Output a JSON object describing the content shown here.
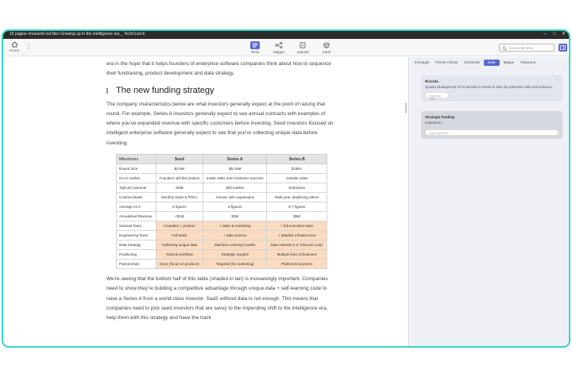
{
  "window": {
    "title": "15 pagine rimanenti nel libro Growing up in the intelligence era _ TechCrunch",
    "controls": [
      "–",
      "□",
      "✕"
    ]
  },
  "toolbar": {
    "home_label": "Home",
    "tools": [
      {
        "label": "Testo",
        "icon": "text-icon",
        "active": true
      },
      {
        "label": "Mappa",
        "icon": "mindmap-icon",
        "active": false
      },
      {
        "label": "Appunti",
        "icon": "notes-icon",
        "active": false
      },
      {
        "label": "Carol",
        "icon": "cube-icon",
        "active": false
      }
    ],
    "search_placeholder": "Cerca nel testo"
  },
  "document": {
    "intro": "era in the hope that it helps founders of enterprise software companies think about how to sequence their fundraising, product development and data strategy.",
    "heading": "The new funding strategy",
    "para1": "The company characteristics below are what investors generally expect at the point of raising that round. For example, Series A investors generally expect to see annual contracts with examples of where you’ve expanded revenue with specific customers before investing. Seed investors focused on intelligent enterprise software generally expect to see that you’re collecting unique data before investing.",
    "table": {
      "headers": [
        "Milestones",
        "Seed",
        "Series A",
        "Series B"
      ],
      "rows": [
        {
          "cells": [
            "Round Size",
            "$2-5M",
            "$5-15M",
            "$15M+"
          ],
          "tan": false
        },
        {
          "cells": [
            "Go to market",
            "Founders sell the product",
            "Inside sales and Customer Success",
            "Outside sales"
          ],
          "tan": false
        },
        {
          "cells": [
            "Typical Customer",
            "SMB",
            "Mid-market",
            "Enterprise"
          ],
          "tan": false
        },
        {
          "cells": [
            "Contract Basis",
            "Monthly SaaS & POCs",
            "Annual, with expansions",
            "Multi-year, displacing others"
          ],
          "tan": false
        },
        {
          "cells": [
            "Average ACV",
            "5 figures",
            "6 figures",
            "6-7 figures"
          ],
          "tan": false
        },
        {
          "cells": [
            "Annualized Revenue",
            "<$1M",
            "$3M",
            "$5M"
          ],
          "tan": false
        },
        {
          "cells": [
            "General Team",
            "Founders + product",
            "+ sales & marketing",
            "+ full executive team"
          ],
          "tan": true
        },
        {
          "cells": [
            "Engineering Team",
            "Full-stack",
            "+ data science",
            "+ data/ML infrastructure"
          ],
          "tan": true
        },
        {
          "cells": [
            "Data Strategy",
            "Collecting unique data",
            "Machine Learning models",
            "Data network is a “Virtuous Loop”"
          ],
          "tan": true
        },
        {
          "cells": [
            "Positioning",
            "Tactical workflow",
            "Strategic insights",
            "Multiple lines of business"
          ],
          "tan": true
        },
        {
          "cells": [
            "Partnerships",
            "None (focus on product!)",
            "Targeted (for marketing)",
            "Platform/ecosystem"
          ],
          "tan": true
        }
      ]
    },
    "para2": "We’re seeing that the bottom half of this table (shaded in tan) is increasingly important. Companies need to show they’re building a competitive advantage through unique data + self-learning code to raise a Series A from a world-class investor. SaaS without data is not enough. This means that companies need to pick seed investors that are savvy to the impending shift to the intelligence era, help them with this strategy and have the track"
  },
  "side_panel": {
    "tabs": [
      {
        "label": "Immagini",
        "active": false
      },
      {
        "label": "Parole Chiave",
        "active": false
      },
      {
        "label": "Domande",
        "active": false
      },
      {
        "label": "Note",
        "active": true
      },
      {
        "label": "Mappe",
        "active": false
      },
      {
        "label": "Riassunti",
        "active": false
      }
    ],
    "cards": [
      {
        "title": "Ricorda",
        "subtitle": "Quanta stratagemma mi ha lanciato in mente le date dei professori nella scena bianca",
        "input_placeholder": "Aggiungi testo..."
      },
      {
        "title": "Strategia funding",
        "subtitle": "Importante...",
        "input_placeholder": "Aggiungi testo..."
      }
    ]
  },
  "colors": {
    "accent": "#5b6ad0",
    "frame": "#35d6c6",
    "tan": "#fbdcc0"
  }
}
